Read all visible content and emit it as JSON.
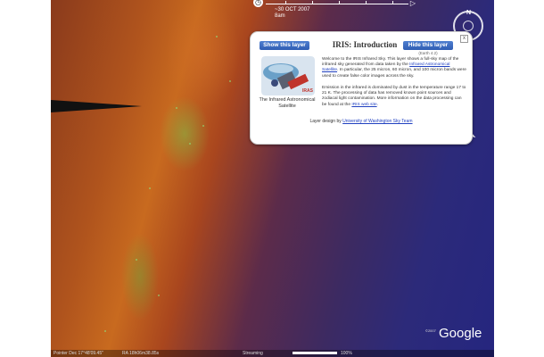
{
  "time_slider": {
    "play_icon": "clock-icon",
    "end_icon": "play-triangle-icon",
    "date_label": "~30 OCT 2007",
    "time_label": "8am"
  },
  "navigation": {
    "north_label": "N"
  },
  "balloon": {
    "show_button": "Show this layer",
    "title": "IRIS: Introduction",
    "hide_button": "Hide this layer",
    "hide_sub": "(Earth 4.2)",
    "close_label": "x",
    "image_caption": "The Infrared Astronomical Satellite",
    "image_badge": "IRAS",
    "para1_text": "Welcome to the IRIS Infrared Sky. This layer shows a full-sky map of the infrared sky generated from data taken by the",
    "para1_link": "Infrared Astronomical Satellite",
    "para1_end": ". In particular, the 25 micron, 60 micron, and 100 micron bands were used to create false color images across the sky.",
    "para2_text": "Emission in the infrared is dominated by dust in the temperature range 17 to 21 K. The processing of data has removed known point sources and zodiacal light contamination. More information on the data processing can be found at the",
    "para2_link": "IRIS web site",
    "para2_end": ".",
    "credit_text": "Layer design by",
    "credit_link": "University of Washington Sky Team"
  },
  "map": {
    "logo": "Google",
    "copyright": "©2007"
  },
  "status": {
    "pointer": "Pointer  Dec 17°48'09.45\"",
    "ra": "RA 18h06m38.85s",
    "streaming_label": "Streaming",
    "streaming_pct": "100%",
    "streaming_progress": 1.0
  },
  "colors": {
    "button": "#2f5db3",
    "link": "#2040c0",
    "iras_badge": "#c0342c"
  }
}
